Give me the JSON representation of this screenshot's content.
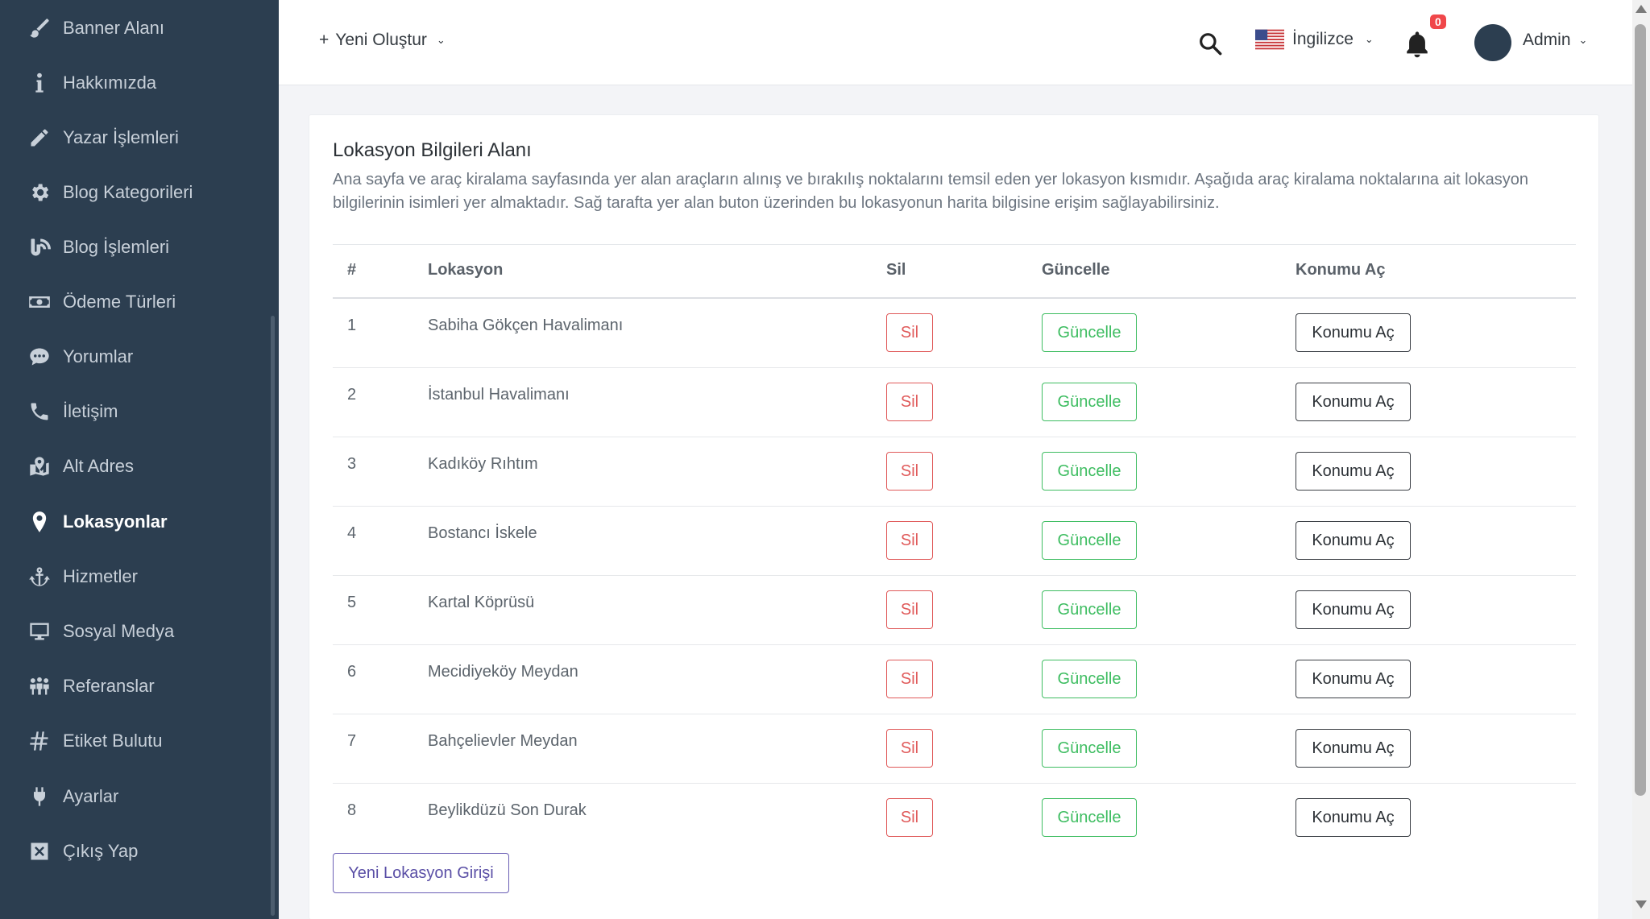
{
  "sidebar": {
    "items": [
      {
        "label": "Banner Alanı",
        "icon": "brush-icon"
      },
      {
        "label": "Hakkımızda",
        "icon": "info-icon"
      },
      {
        "label": "Yazar İşlemleri",
        "icon": "pencil-icon"
      },
      {
        "label": "Blog Kategorileri",
        "icon": "cog-icon"
      },
      {
        "label": "Blog İşlemleri",
        "icon": "blog-icon"
      },
      {
        "label": "Ödeme Türleri",
        "icon": "money-icon"
      },
      {
        "label": "Yorumlar",
        "icon": "comment-icon"
      },
      {
        "label": "İletişim",
        "icon": "phone-icon"
      },
      {
        "label": "Alt Adres",
        "icon": "map-icon"
      },
      {
        "label": "Lokasyonlar",
        "icon": "map-marker-icon"
      },
      {
        "label": "Hizmetler",
        "icon": "anchor-icon"
      },
      {
        "label": "Sosyal Medya",
        "icon": "desktop-icon"
      },
      {
        "label": "Referanslar",
        "icon": "users-icon"
      },
      {
        "label": "Etiket Bulutu",
        "icon": "hashtag-icon"
      },
      {
        "label": "Ayarlar",
        "icon": "plug-icon"
      },
      {
        "label": "Çıkış Yap",
        "icon": "close-square-icon"
      }
    ],
    "active": "Lokasyonlar"
  },
  "topbar": {
    "new_label": "Yeni Oluştur",
    "new_prefix": "+",
    "language": "İngilizce",
    "notification_count": "0",
    "user": "Admin"
  },
  "card": {
    "title": "Lokasyon Bilgileri Alanı",
    "description": "Ana sayfa ve araç kiralama sayfasında yer alan araçların alınış ve bırakılış noktalarını temsil eden yer lokasyon kısmıdır. Aşağıda araç kiralama noktalarına ait lokasyon bilgilerinin isimleri yer almaktadır. Sağ tarafta yer alan buton üzerinden bu lokasyonun harita bilgisine erişim sağlayabilirsiniz.",
    "columns": {
      "num": "#",
      "location": "Lokasyon",
      "delete": "Sil",
      "update": "Güncelle",
      "open": "Konumu Aç"
    },
    "rows": [
      {
        "num": "1",
        "location": "Sabiha Gökçen Havalimanı"
      },
      {
        "num": "2",
        "location": "İstanbul Havalimanı"
      },
      {
        "num": "3",
        "location": "Kadıköy Rıhtım"
      },
      {
        "num": "4",
        "location": "Bostancı İskele"
      },
      {
        "num": "5",
        "location": "Kartal Köprüsü"
      },
      {
        "num": "6",
        "location": "Mecidiyeköy Meydan"
      },
      {
        "num": "7",
        "location": "Bahçelievler Meydan"
      },
      {
        "num": "8",
        "location": "Beylikdüzü Son Durak"
      }
    ],
    "buttons": {
      "delete": "Sil",
      "update": "Güncelle",
      "open": "Konumu Aç"
    },
    "new_location_label": "Yeni Lokasyon Girişi"
  },
  "colors": {
    "sidebar_bg": "#2c3e50",
    "danger": "#e05a5a",
    "success": "#3ebd61",
    "primary_outline": "#6b5fb5",
    "badge": "#f0474a"
  }
}
